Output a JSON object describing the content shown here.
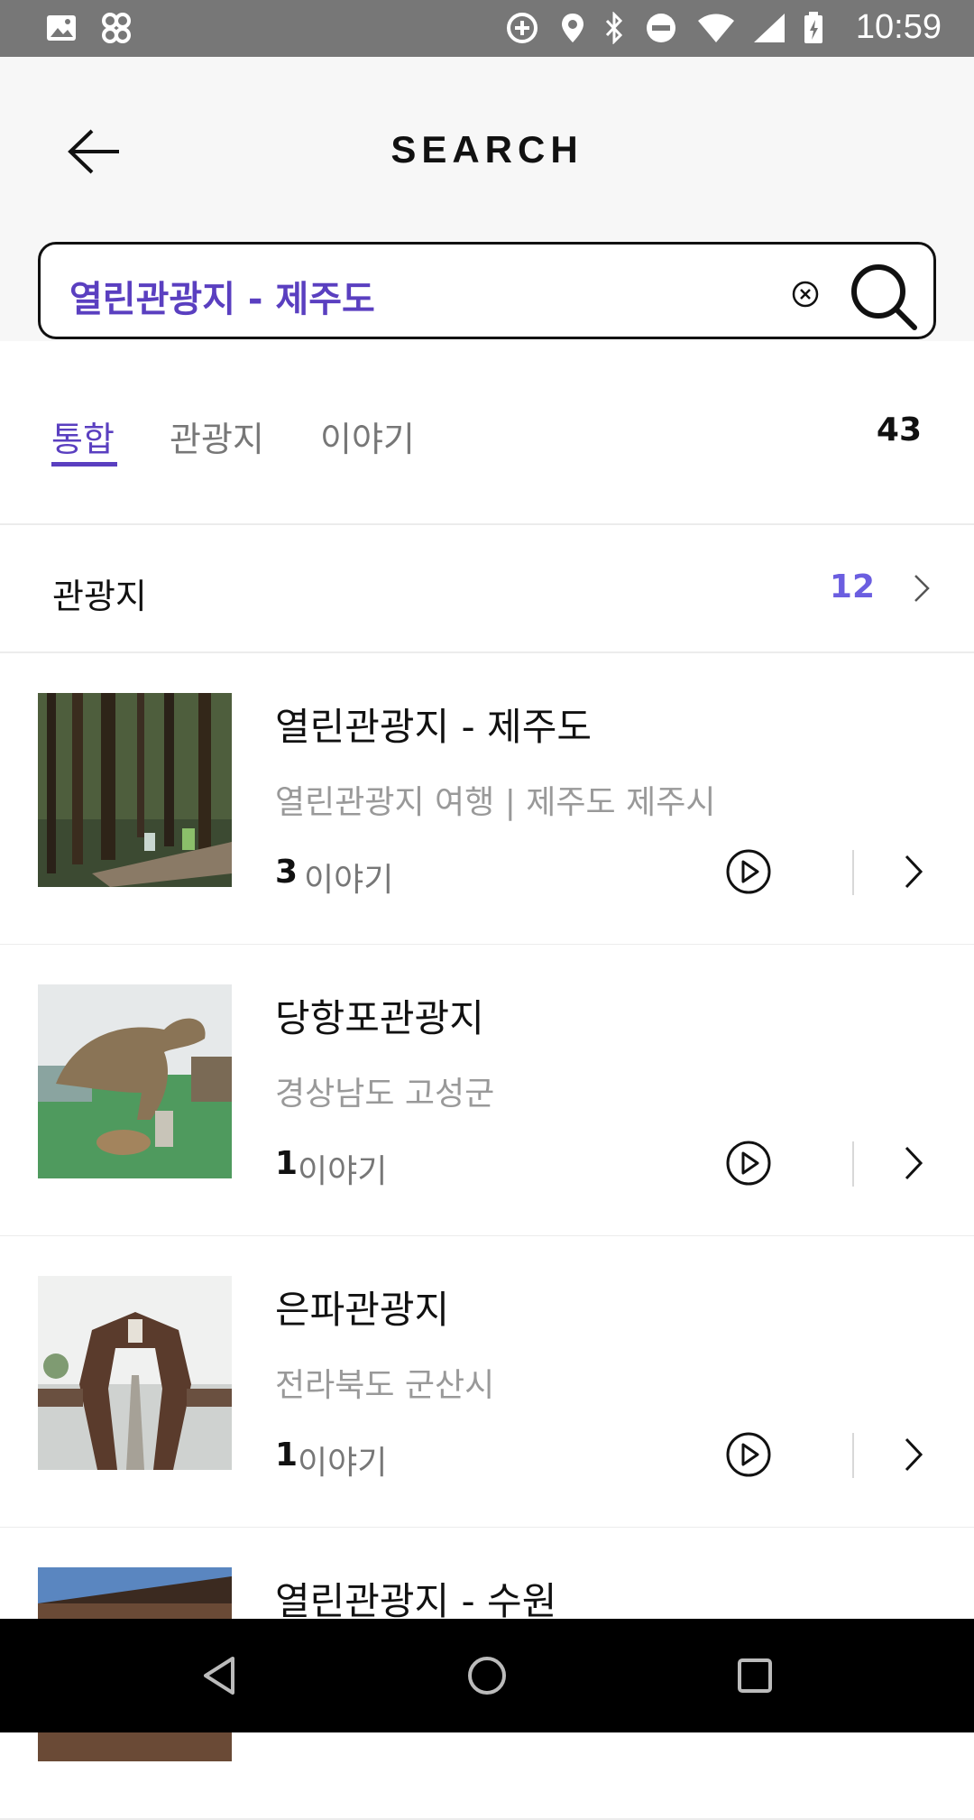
{
  "status_bar": {
    "time": "10:59"
  },
  "header": {
    "title": "SEARCH"
  },
  "search": {
    "query": "열린관광지 - 제주도"
  },
  "tabs": [
    {
      "label": "통합",
      "active": true
    },
    {
      "label": "관광지",
      "active": false
    },
    {
      "label": "이야기",
      "active": false
    }
  ],
  "total_count": "43",
  "section": {
    "title": "관광지",
    "count": "12"
  },
  "items": [
    {
      "title": "열린관광지 - 제주도",
      "subtitle": "열린관광지 여행 | 제주도 제주시",
      "count": "3",
      "count_label": "이야기"
    },
    {
      "title": "당항포관광지",
      "subtitle": "경상남도 고성군",
      "count": "1",
      "count_label": "이야기"
    },
    {
      "title": "은파관광지",
      "subtitle": "전라북도 군산시",
      "count": "1",
      "count_label": "이야기"
    },
    {
      "title": "열린관광지 - 수원"
    }
  ],
  "colors": {
    "accent": "#5a3fc0",
    "count_accent": "#6b5ee0",
    "status_bar": "#777777"
  }
}
